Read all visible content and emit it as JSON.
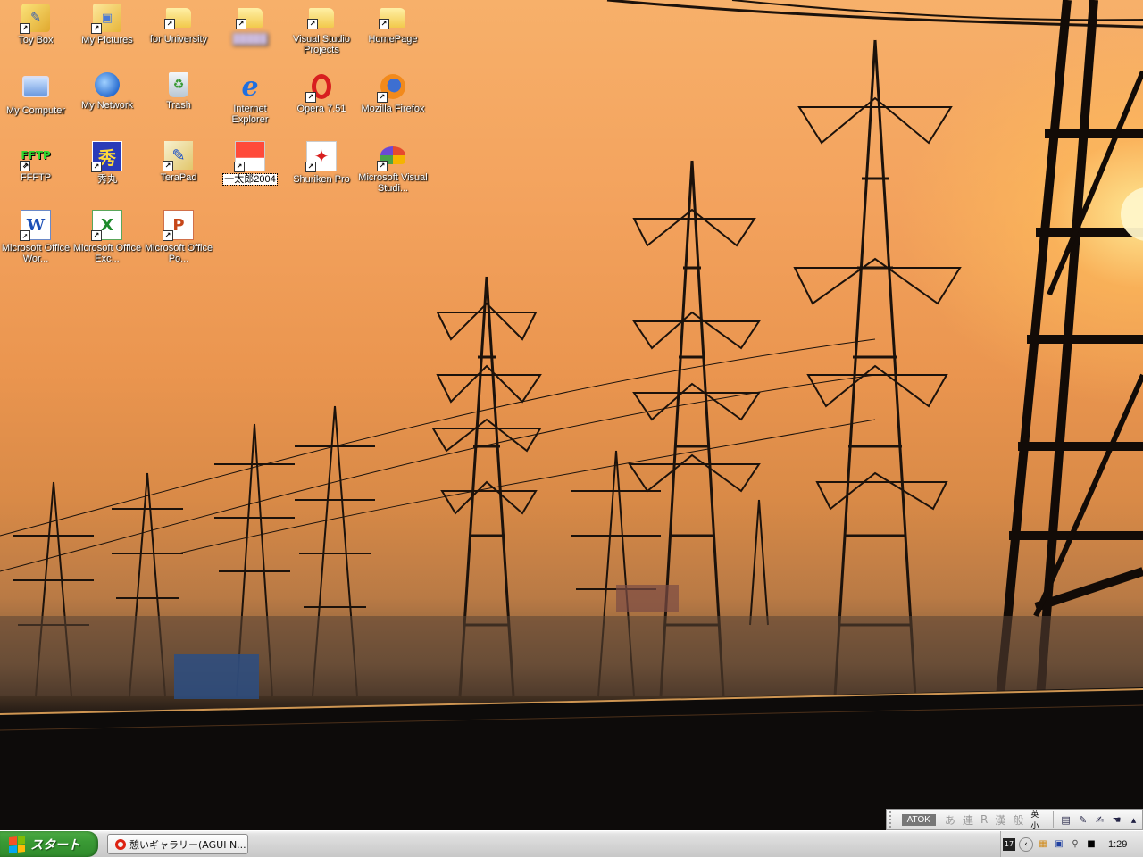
{
  "desktop": {
    "icons": [
      {
        "label": "Toy Box"
      },
      {
        "label": "My Pictures"
      },
      {
        "label": "for University"
      },
      {
        "label": "█████"
      },
      {
        "label": "Visual Studio Projects"
      },
      {
        "label": "HomePage"
      },
      {
        "label": "My Computer"
      },
      {
        "label": "My Network"
      },
      {
        "label": "Trash"
      },
      {
        "label": "Internet Explorer"
      },
      {
        "label": "Opera 7.51"
      },
      {
        "label": "Mozilla Firefox"
      },
      {
        "label": "FFFTP"
      },
      {
        "label": "秀丸"
      },
      {
        "label": "TeraPad"
      },
      {
        "label": "一太郎2004"
      },
      {
        "label": "Shuriken Pro"
      },
      {
        "label": "Microsoft Visual Studi..."
      },
      {
        "label": "Microsoft Office Wor..."
      },
      {
        "label": "Microsoft Office Exc..."
      },
      {
        "label": "Microsoft Office Po..."
      }
    ]
  },
  "langbar": {
    "atok": "ATOK",
    "mode_a": "あ",
    "mode_ren": "連",
    "mode_r": "R",
    "mode_kan": "漢",
    "mode_han": "般",
    "mode_eisho": "英小"
  },
  "taskbar": {
    "start_label": "スタート",
    "window_title": "憩いギャラリー(AGUI N...",
    "clock": "1:29"
  },
  "colors": {
    "sky_top": "#f7b06a",
    "start_green": "#3a9a35"
  }
}
